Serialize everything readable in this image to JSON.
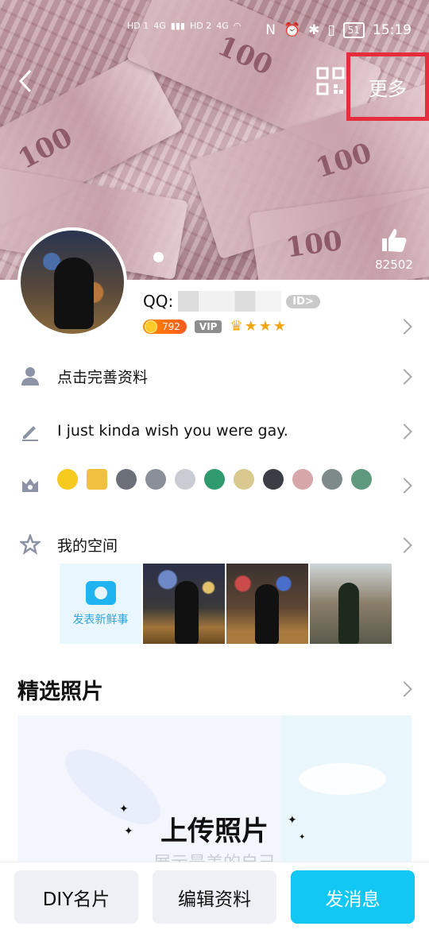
{
  "status_bar": {
    "left_indicators": [
      "HD 1",
      "4G",
      "HD 2",
      "4G"
    ],
    "battery": "51",
    "time": "15:19"
  },
  "header": {
    "more_label": "更多",
    "like_count": "82502"
  },
  "profile": {
    "qq_label": "QQ:",
    "id_badge": "ID>",
    "level_value": "792",
    "vip_label": "VIP"
  },
  "rows": {
    "complete_profile": "点击完善资料",
    "signature": "I just kinda wish you were gay.",
    "my_space": "我的空间"
  },
  "space": {
    "post_label": "发表新鲜事"
  },
  "featured": {
    "title": "精选照片",
    "upload_title": "上传照片",
    "upload_sub": "展示最美的自己"
  },
  "bottom": {
    "diy_card": "DIY名片",
    "edit_profile": "编辑资料",
    "send_message": "发消息"
  },
  "colors": {
    "accent": "#12c7f3",
    "highlight_box": "#e62d3c"
  }
}
